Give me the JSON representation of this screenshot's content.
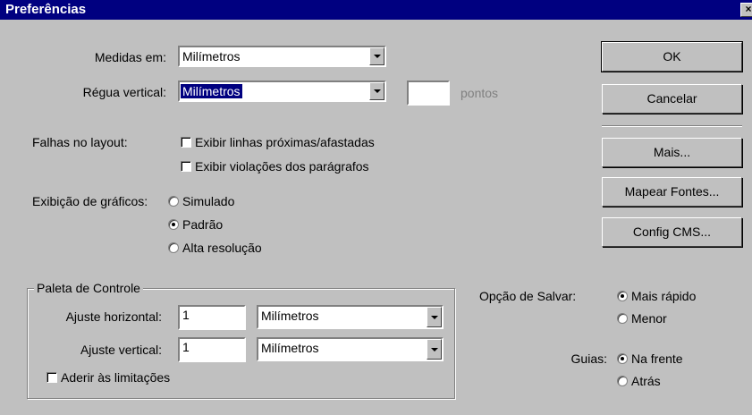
{
  "window": {
    "title": "Preferências",
    "close_glyph": "×"
  },
  "units": {
    "measures_label": "Medidas em:",
    "measures_value": "Milímetros",
    "ruler_label": "Régua vertical:",
    "ruler_value": "Milímetros",
    "points_value": "",
    "points_label": "pontos"
  },
  "layout_flaws": {
    "label": "Falhas no layout:",
    "opt1": "Exibir linhas próximas/afastadas",
    "opt2": "Exibir violações dos parágrafos"
  },
  "graphics": {
    "label": "Exibição de gráficos:",
    "opt1": "Simulado",
    "opt2": "Padrão",
    "opt3": "Alta resolução",
    "selected": "Padrão"
  },
  "palette": {
    "legend": "Paleta de Controle",
    "h_label": "Ajuste horizontal:",
    "h_value": "1",
    "h_unit": "Milímetros",
    "v_label": "Ajuste vertical:",
    "v_value": "1",
    "v_unit": "Milímetros",
    "snap_label": "Aderir às limitações"
  },
  "save": {
    "label": "Opção de Salvar:",
    "opt1": "Mais rápido",
    "opt2": "Menor",
    "selected": "Mais rápido"
  },
  "guides": {
    "label": "Guias:",
    "opt1": "Na frente",
    "opt2": "Atrás",
    "selected": "Na frente"
  },
  "buttons": {
    "ok": "OK",
    "cancel": "Cancelar",
    "more": "Mais...",
    "map_fonts": "Mapear Fontes...",
    "cms": "Config CMS..."
  }
}
